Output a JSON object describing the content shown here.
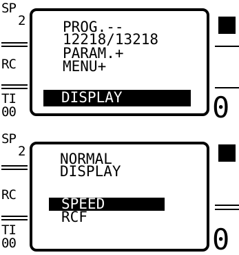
{
  "screens": [
    {
      "side": {
        "sp_label": "SP",
        "sp_value": "2",
        "rc_label": "RC",
        "ti_label": "TI",
        "ti_value": "00"
      },
      "menu": [
        {
          "text": "PROG.--",
          "highlighted": false
        },
        {
          "text": "12218/13218",
          "highlighted": false
        },
        {
          "text": "PARAM.+",
          "highlighted": false
        },
        {
          "text": "MENU+",
          "highlighted": false
        },
        {
          "text": "DISPLAY",
          "highlighted": true
        }
      ],
      "right_digit": "0"
    },
    {
      "side": {
        "sp_label": "SP",
        "sp_value": "2",
        "rc_label": "RC",
        "ti_label": "TI",
        "ti_value": "00"
      },
      "menu": [
        {
          "text": "NORMAL",
          "highlighted": false
        },
        {
          "text": "DISPLAY",
          "highlighted": false
        },
        {
          "text": "SPEED",
          "highlighted": true
        },
        {
          "text": "RCF",
          "highlighted": false
        }
      ],
      "right_digit": "0"
    }
  ]
}
